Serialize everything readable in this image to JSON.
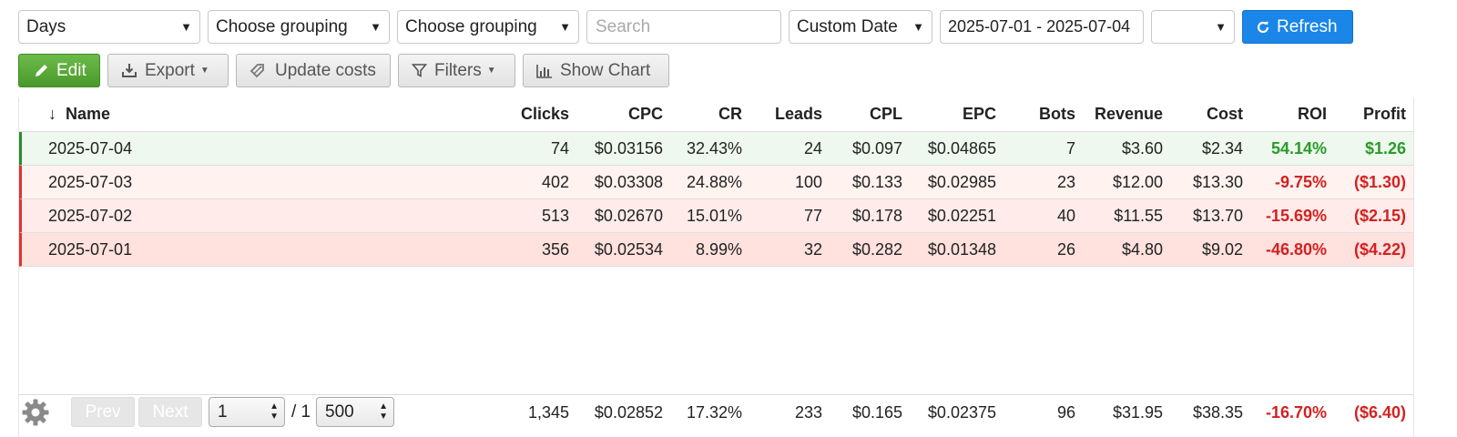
{
  "filters": {
    "group1": "Days",
    "group2": "Choose grouping",
    "group3": "Choose grouping",
    "search_placeholder": "Search",
    "date_mode": "Custom Date",
    "date_range": "2025-07-01 - 2025-07-04",
    "extra_select": "",
    "refresh_label": "Refresh"
  },
  "toolbar": {
    "edit_label": "Edit",
    "export_label": "Export",
    "update_costs_label": "Update costs",
    "filters_label": "Filters",
    "show_chart_label": "Show Chart"
  },
  "table": {
    "sort_indicator": "↓",
    "columns": [
      "Name",
      "Clicks",
      "CPC",
      "CR",
      "Leads",
      "CPL",
      "EPC",
      "Bots",
      "Revenue",
      "Cost",
      "ROI",
      "Profit"
    ],
    "rows": [
      [
        "2025-07-04",
        "74",
        "$0.03156",
        "32.43%",
        "24",
        "$0.097",
        "$0.04865",
        "7",
        "$3.60",
        "$2.34",
        "54.14%",
        "$1.26"
      ],
      [
        "2025-07-03",
        "402",
        "$0.03308",
        "24.88%",
        "100",
        "$0.133",
        "$0.02985",
        "23",
        "$12.00",
        "$13.30",
        "-9.75%",
        "($1.30)"
      ],
      [
        "2025-07-02",
        "513",
        "$0.02670",
        "15.01%",
        "77",
        "$0.178",
        "$0.02251",
        "40",
        "$11.55",
        "$13.70",
        "-15.69%",
        "($2.15)"
      ],
      [
        "2025-07-01",
        "356",
        "$0.02534",
        "8.99%",
        "32",
        "$0.282",
        "$0.01348",
        "26",
        "$4.80",
        "$9.02",
        "-46.80%",
        "($4.22)"
      ]
    ],
    "totals": [
      "",
      "1,345",
      "$0.02852",
      "17.32%",
      "233",
      "$0.165",
      "$0.02375",
      "96",
      "$31.95",
      "$38.35",
      "-16.70%",
      "($6.40)"
    ]
  },
  "pagination": {
    "prev_label": "Prev",
    "next_label": "Next",
    "page": "1",
    "total_pages": "/ 1",
    "page_size": "500"
  },
  "colors": {
    "accent_blue": "#1a86e8",
    "edit_green": "#4a9a2b",
    "positive": "#2a9b2a",
    "negative": "#d42121"
  }
}
